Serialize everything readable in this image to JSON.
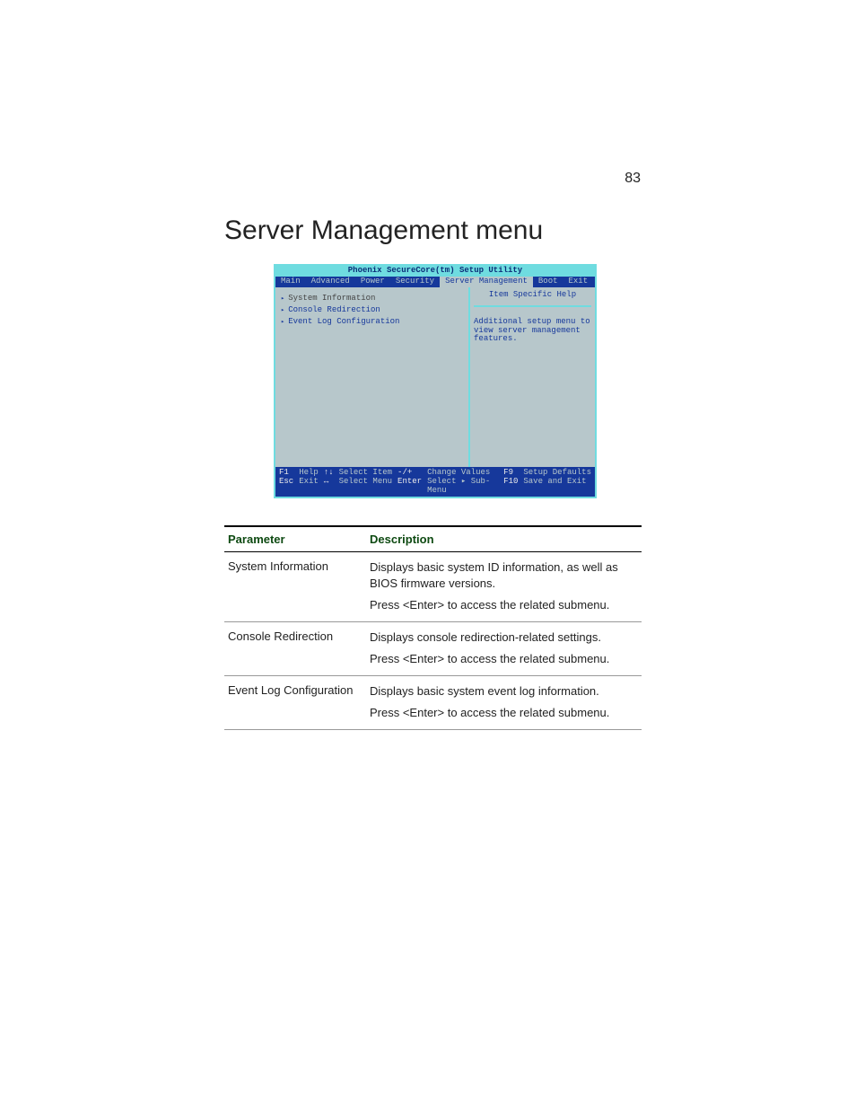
{
  "page_number": "83",
  "heading": "Server Management menu",
  "bios": {
    "utility_title": "Phoenix SecureCore(tm) Setup Utility",
    "tabs": [
      "Main",
      "Advanced",
      "Power",
      "Security",
      "Server Management",
      "Boot",
      "Exit"
    ],
    "selected_tab_index": 4,
    "menu_items": [
      "System Information",
      "Console Redirection",
      "Event Log Configuration"
    ],
    "highlighted_menu_index": 0,
    "help_title": "Item Specific Help",
    "help_text": "Additional setup menu to view server management features.",
    "footer": [
      {
        "key": "F1",
        "label": "Help"
      },
      {
        "key": "↑↓",
        "label": "Select Item"
      },
      {
        "key": "-/+",
        "label": "Change Values"
      },
      {
        "key": "F9",
        "label": "Setup Defaults"
      },
      {
        "key": "Esc",
        "label": "Exit"
      },
      {
        "key": "↔",
        "label": "Select Menu"
      },
      {
        "key": "Enter",
        "label": "Select ▸ Sub-Menu"
      },
      {
        "key": "F10",
        "label": "Save and Exit"
      }
    ]
  },
  "table": {
    "headers": [
      "Parameter",
      "Description"
    ],
    "rows": [
      {
        "param": "System Information",
        "desc": [
          "Displays basic system ID information, as well as BIOS firmware versions.",
          "Press <Enter> to access the related submenu."
        ]
      },
      {
        "param": "Console Redirection",
        "desc": [
          "Displays console redirection-related settings.",
          "Press <Enter> to access the related submenu."
        ]
      },
      {
        "param": "Event Log Configuration",
        "desc": [
          "Displays basic system event log information.",
          "Press <Enter> to access the related submenu."
        ]
      }
    ]
  }
}
